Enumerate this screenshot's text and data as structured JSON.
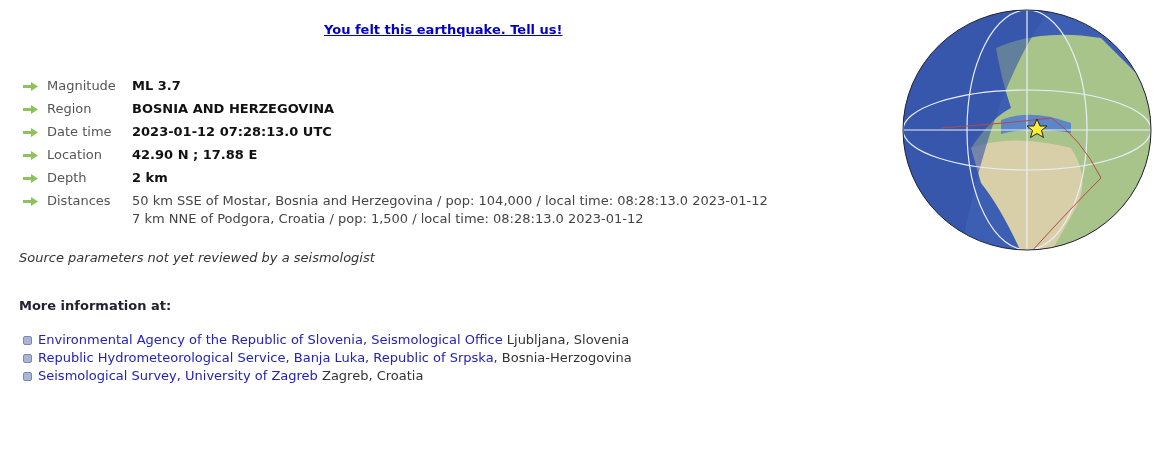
{
  "feedback_link": "You felt this earthquake. Tell us!",
  "details": [
    {
      "label": "Magnitude",
      "kind": "bold",
      "value": "ML 3.7"
    },
    {
      "label": "Region",
      "kind": "bold",
      "value": "BOSNIA AND HERZEGOVINA"
    },
    {
      "label": "Date time",
      "kind": "bold",
      "value": "2023-01-12 07:28:13.0 UTC"
    },
    {
      "label": "Location",
      "kind": "bold",
      "value": "42.90 N ; 17.88 E"
    },
    {
      "label": "Depth",
      "kind": "bold",
      "value": "2 km"
    },
    {
      "label": "Distances",
      "kind": "lines",
      "lines": [
        "50 km SSE of Mostar, Bosnia and Herzegovina / pop: 104,000 / local time: 08:28:13.0 2023-01-12",
        "7 km NNE of Podgora, Croatia / pop: 1,500 / local time: 08:28:13.0 2023-01-12"
      ]
    }
  ],
  "review_note": "Source parameters not yet reviewed by a seismologist",
  "more_info": {
    "heading": "More information at:",
    "sources": [
      {
        "link": "Environmental Agency of the Republic of Slovenia, Seismological Office",
        "place": " Ljubljana, Slovenia"
      },
      {
        "link": "Republic Hydrometeorological Service, Banja Luka, Republic of Srpska",
        "place": ", Bosnia-Herzogovina"
      },
      {
        "link": "Seismological Survey, University of Zagreb",
        "place": " Zagreb, Croatia"
      }
    ]
  }
}
